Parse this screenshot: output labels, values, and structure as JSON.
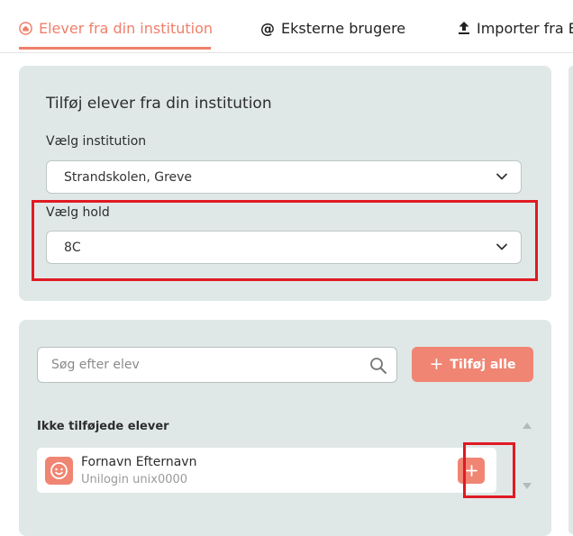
{
  "tabs": [
    {
      "label": "Elever fra din institution",
      "icon": "house-icon",
      "active": true
    },
    {
      "label": "Eksterne brugere",
      "icon": "at-icon",
      "active": false
    },
    {
      "label": "Importer fra E",
      "icon": "upload-icon",
      "active": false
    }
  ],
  "institution_panel": {
    "title": "Tilføj elever fra din institution",
    "institution_label": "Vælg institution",
    "institution_value": "Strandskolen, Greve",
    "class_label": "Vælg hold",
    "class_value": "8C"
  },
  "students_panel": {
    "search_placeholder": "Søg efter elev",
    "add_all_label": "Tilføj alle",
    "section_label": "Ikke tilføjede elever",
    "students": [
      {
        "name": "Fornavn Efternavn",
        "login": "Unilogin unix0000"
      }
    ]
  },
  "colors": {
    "accent": "#f07f6a",
    "button": "#f08573",
    "panel": "#dfe8e7",
    "highlight": "#e01a23"
  }
}
